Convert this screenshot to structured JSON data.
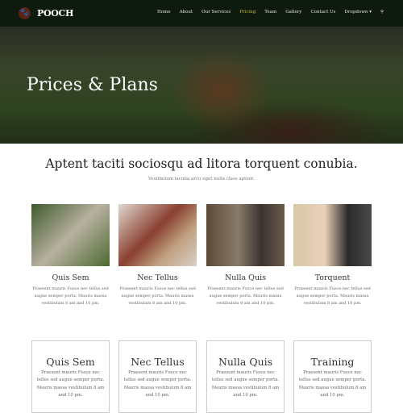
{
  "nav": {
    "brand": "POOCH",
    "logo_icon": "paw-icon",
    "items": [
      "Home",
      "About",
      "Our Services",
      "Pricing",
      "Team",
      "Gallery",
      "Contact Us",
      "Dropdown ▾"
    ],
    "active": "Pricing",
    "search_icon": "search-icon",
    "accent": "#c8b93a"
  },
  "hero": {
    "title": "Prices & Plans"
  },
  "section": {
    "title": "Aptent taciti sociosqu ad litora torquent conubia.",
    "subtitle": "Vestibulum lacinia arcu eget nulla class aptent."
  },
  "cards": [
    {
      "title": "Quis Sem",
      "text": "Praesent mauris Fusce nec tellus sed augue semper porta. Mauris massa vestibulum 8 am and 10 pm."
    },
    {
      "title": "Nec Tellus",
      "text": "Praesent mauris Fusce nec tellus sed augue semper porta. Mauris massa vestibulum 8 am and 10 pm."
    },
    {
      "title": "Nulla Quis",
      "text": "Praesent mauris Fusce nec tellus sed augue semper porta. Mauris massa vestibulum 8 am and 10 pm."
    },
    {
      "title": "Torquent",
      "text": "Praesent mauris Fusce nec tellus sed augue semper porta. Mauris massa vestibulum 8 am and 10 pm."
    }
  ],
  "plans": [
    {
      "title": "Quis Sem",
      "text": "Praesent mauris Fusce nec tellus sed augue semper porta. Mauris massa vestibulum 8 am and 10 pm."
    },
    {
      "title": "Nec Tellus",
      "text": "Praesent mauris Fusce nec tellus sed augue semper porta. Mauris massa vestibulum 8 am and 10 pm."
    },
    {
      "title": "Nulla Quis",
      "text": "Praesent mauris Fusce nec tellus sed augue semper porta. Mauris massa vestibulum 8 am and 10 pm."
    },
    {
      "title": "Training",
      "text": "Praesent mauris Fusce nec tellus sed augue semper porta. Mauris massa vestibulum 8 am and 10 pm."
    }
  ]
}
